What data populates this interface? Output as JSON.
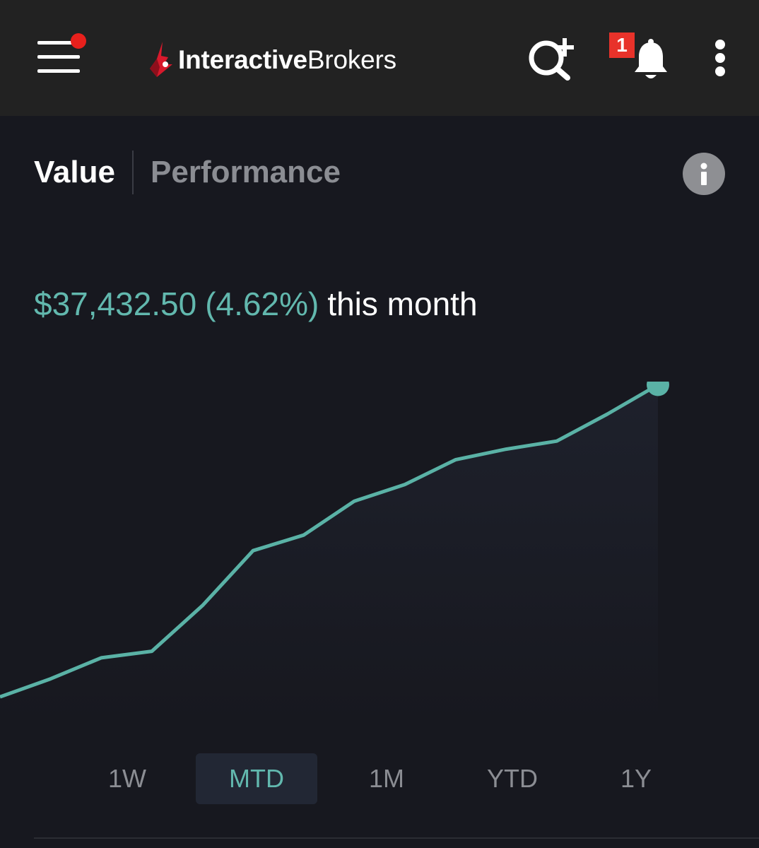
{
  "header": {
    "logo_text_bold": "Interactive",
    "logo_text_regular": "Brokers",
    "notification_count": "1",
    "icons": {
      "menu": "hamburger-menu-icon",
      "search": "search-add-icon",
      "bell": "bell-icon",
      "more": "kebab-menu-icon"
    },
    "colors": {
      "background": "#222222",
      "notification_dot": "#e8201c",
      "badge": "#e8322a",
      "logo_mark": "#d7192c"
    }
  },
  "tabs": [
    {
      "label": "Value",
      "active": true
    },
    {
      "label": "Performance",
      "active": false
    }
  ],
  "info_icon": "info-icon",
  "summary": {
    "amount": "$37,432.50",
    "percent": "(4.62%)",
    "suffix": "this month"
  },
  "chart_data": {
    "type": "area",
    "series": [
      {
        "values": [
          8.3,
          14.6,
          21.9,
          24.2,
          40.1,
          59.2,
          64.6,
          76.4,
          82.2,
          90.8,
          94.5,
          97.3,
          106.7,
          116.9
        ]
      }
    ],
    "ylim": [
      0,
      118
    ],
    "grid": false,
    "colors": {
      "line": "#5ab2a6",
      "fill": "#1e212c",
      "background": "#17181f"
    }
  },
  "ranges": [
    {
      "label": "1W",
      "active": false
    },
    {
      "label": "MTD",
      "active": true
    },
    {
      "label": "1M",
      "active": false
    },
    {
      "label": "YTD",
      "active": false
    },
    {
      "label": "1Y",
      "active": false
    }
  ],
  "theme": {
    "background": "#17181f",
    "accent": "#62b8ae",
    "muted_text": "#8b8d93"
  }
}
